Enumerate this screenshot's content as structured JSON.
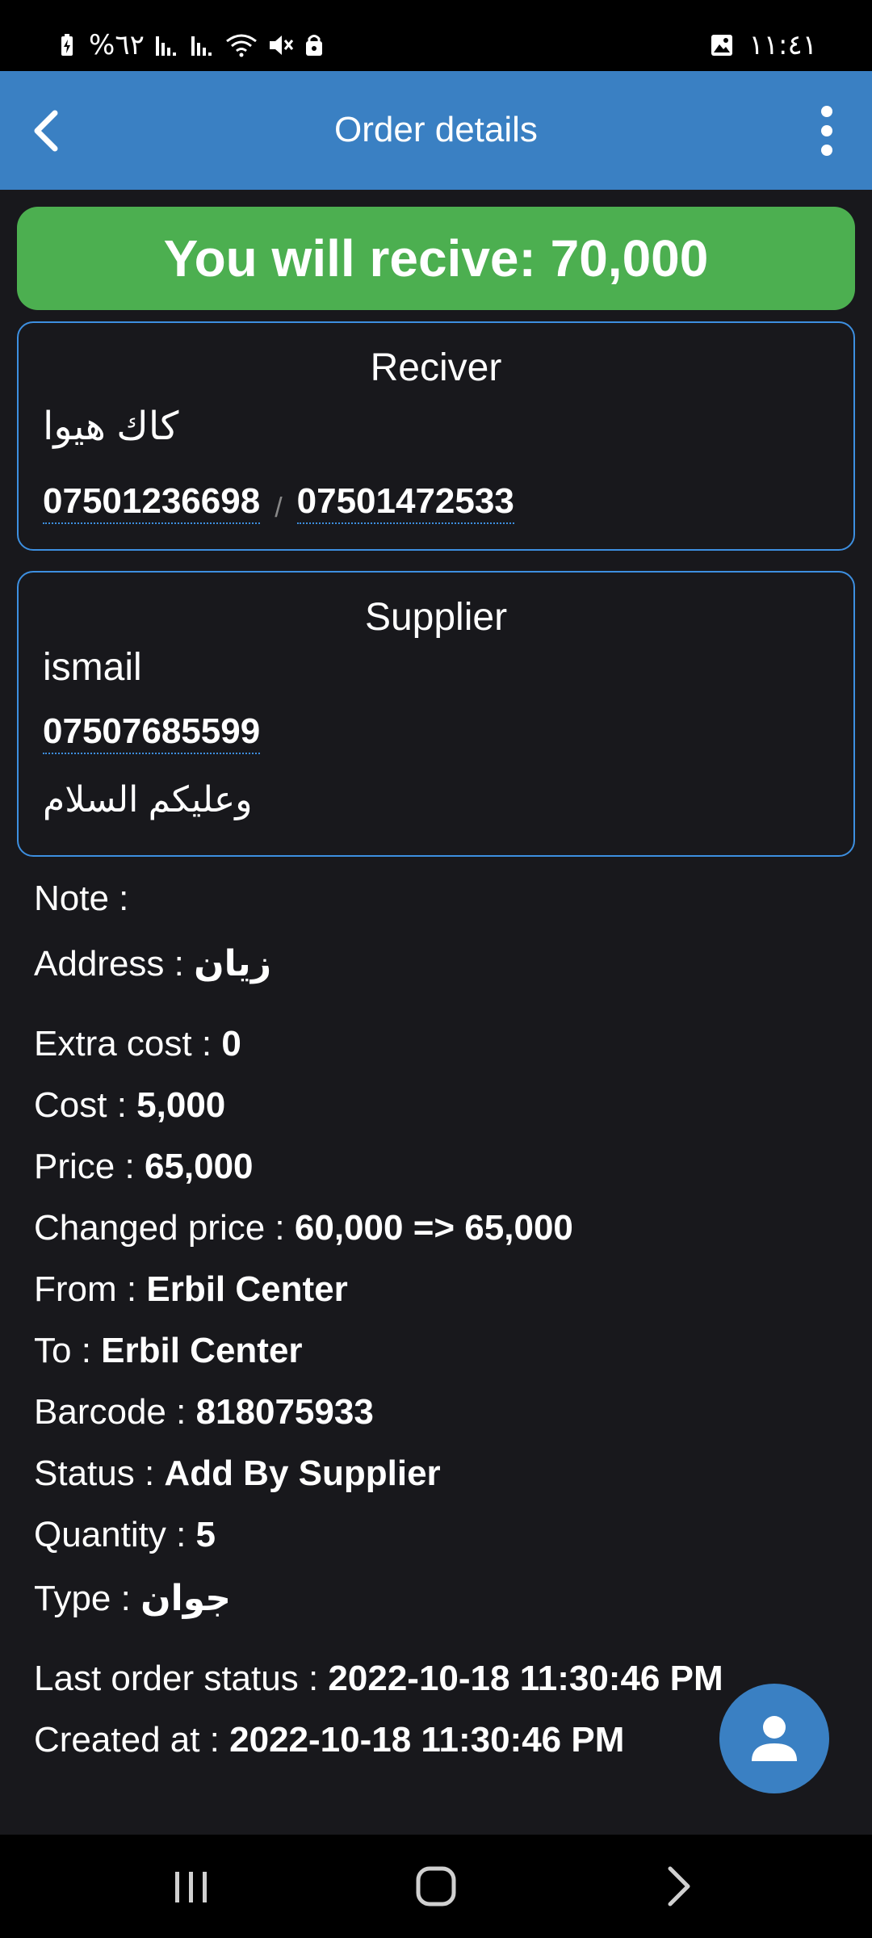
{
  "status_bar": {
    "battery": "%٦٢",
    "time": "١١:٤١",
    "icons": [
      "battery-icon",
      "signal-icon",
      "signal-icon",
      "wifi-icon",
      "mute-icon",
      "lock-icon",
      "gallery-icon"
    ]
  },
  "app_bar": {
    "title": "Order details",
    "back_icon": "chevron-left-icon",
    "menu_icon": "more-vert-icon"
  },
  "receive_banner": {
    "text": "You will recive: 70,000",
    "color": "#4caf50"
  },
  "receiver": {
    "title": "Reciver",
    "name": "كاك هيوا",
    "phones": [
      "07501236698",
      "07501472533"
    ],
    "separator": "/"
  },
  "supplier": {
    "title": "Supplier",
    "name": "ismail",
    "phone": "07507685599",
    "note": "وعليكم السلام"
  },
  "details": {
    "note_label": "Note :",
    "address_label": "Address :",
    "address_value": "زيان",
    "extra_cost_label": "Extra cost :",
    "extra_cost_value": "0",
    "cost_label": "Cost :",
    "cost_value": "5,000",
    "price_label": "Price :",
    "price_value": "65,000",
    "changed_price_label": "Changed price :",
    "changed_price_value": "60,000 => 65,000",
    "from_label": "From :",
    "from_value": "Erbil Center",
    "to_label": "To :",
    "to_value": "Erbil Center",
    "barcode_label": "Barcode :",
    "barcode_value": "818075933",
    "status_label": "Status :",
    "status_value": "Add By Supplier",
    "quantity_label": "Quantity :",
    "quantity_value": "5",
    "type_label": "Type :",
    "type_value": "جوان",
    "last_status_label": "Last order status :",
    "last_status_value": "2022-10-18 11:30:46 PM",
    "created_label": "Created at :",
    "created_value": "2022-10-18 11:30:46 PM"
  },
  "fab": {
    "icon": "person-icon"
  },
  "nav_bar": {
    "icons": [
      "recent-apps-icon",
      "home-icon",
      "back-icon"
    ]
  },
  "colors": {
    "accent": "#3a80c3",
    "background": "#18181c",
    "card_border": "#3d8fe0",
    "success": "#4caf50"
  }
}
